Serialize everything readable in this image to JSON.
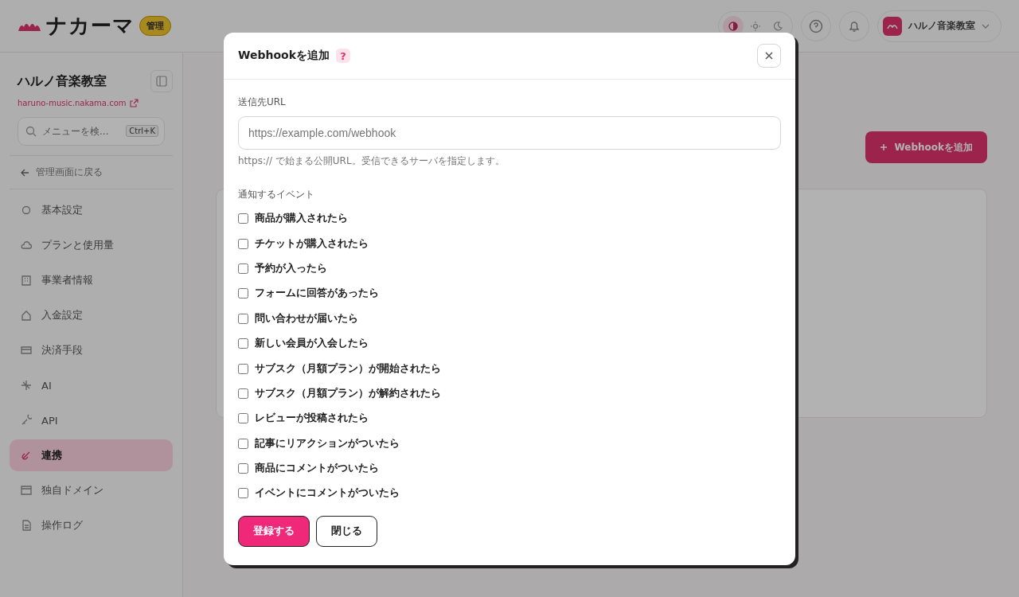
{
  "header": {
    "logo": "ナカーマ",
    "badge": "管理",
    "theme_modes": [
      {
        "selected": true
      },
      {
        "selected": false
      },
      {
        "selected": false
      }
    ],
    "account": "ハルノ音楽教室"
  },
  "sidebar": {
    "shop_name": "ハルノ音楽教室",
    "url": "haruno-music.nakama.com",
    "search": {
      "placeholder": "メニューを検...",
      "shortcut": "Ctrl+K"
    },
    "back_link": "管理画面に戻る",
    "items": [
      {
        "label": "基本設定",
        "selected": false
      },
      {
        "label": "プランと使用量",
        "selected": false
      },
      {
        "label": "事業者情報",
        "selected": false
      },
      {
        "label": "入金設定",
        "selected": false
      },
      {
        "label": "決済手段",
        "selected": false
      },
      {
        "label": "AI",
        "selected": false
      },
      {
        "label": "API",
        "selected": false
      },
      {
        "label": "連携",
        "selected": true
      },
      {
        "label": "独自ドメイン",
        "selected": false
      },
      {
        "label": "操作ログ",
        "selected": false
      }
    ]
  },
  "main": {
    "add_button": "Webhookを追加"
  },
  "modal": {
    "title": "Webhookを追加",
    "help": "?",
    "url_label": "送信先URL",
    "url_placeholder": "https://example.com/webhook",
    "url_hint": "https:// で始まる公開URL。受信できるサーバを指定します。",
    "events_label": "通知するイベント",
    "events": [
      {
        "label": "商品が購入されたら",
        "checked": false
      },
      {
        "label": "チケットが購入されたら",
        "checked": false
      },
      {
        "label": "予約が入ったら",
        "checked": false
      },
      {
        "label": "フォームに回答があったら",
        "checked": false
      },
      {
        "label": "問い合わせが届いたら",
        "checked": false
      },
      {
        "label": "新しい会員が入会したら",
        "checked": false
      },
      {
        "label": "サブスク（月額プラン）が開始されたら",
        "checked": false
      },
      {
        "label": "サブスク（月額プラン）が解約されたら",
        "checked": false
      },
      {
        "label": "レビューが投稿されたら",
        "checked": false
      },
      {
        "label": "記事にリアクションがついたら",
        "checked": false
      },
      {
        "label": "商品にコメントがついたら",
        "checked": false
      },
      {
        "label": "イベントにコメントがついたら",
        "checked": false
      }
    ],
    "buttons": [
      {
        "label": "登録する",
        "kind": "primary"
      },
      {
        "label": "閉じる",
        "kind": "secondary"
      }
    ]
  }
}
